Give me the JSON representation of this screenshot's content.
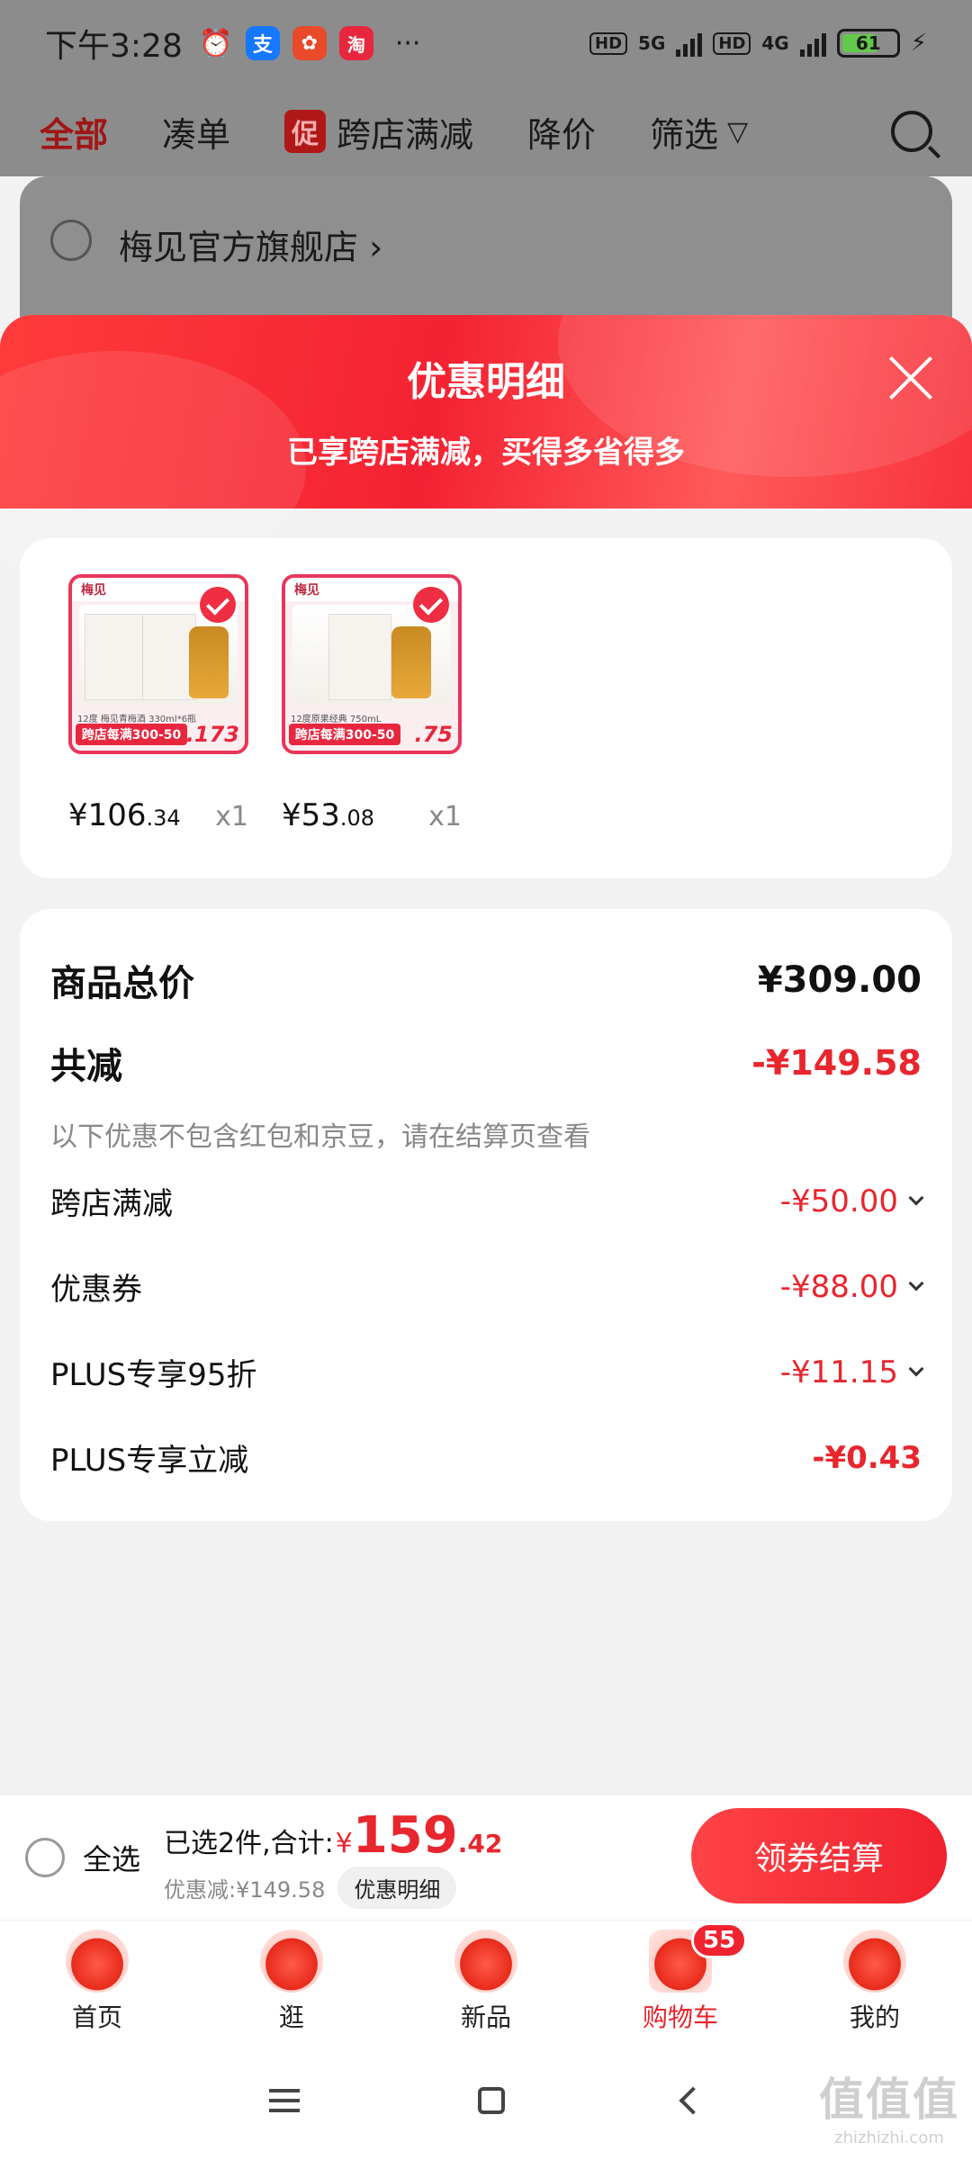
{
  "status_bar": {
    "time": "下午3:28",
    "apps": [
      {
        "name": "alarm-icon",
        "glyph": "⏰",
        "color": "#8c8c8c"
      },
      {
        "name": "alipay-icon",
        "glyph": "支",
        "color": "#1677ff"
      },
      {
        "name": "app-icon",
        "glyph": "✿",
        "color": "#e84a2a"
      },
      {
        "name": "taobao-icon",
        "glyph": "淘",
        "color": "#e8263e"
      }
    ],
    "more": "···",
    "hd1": "HD",
    "net1": "5G",
    "hd2": "HD",
    "net2": "4G",
    "battery": "61"
  },
  "top_tabs": {
    "all": "全部",
    "coudan": "凑单",
    "promo_badge": "促",
    "cross_store": "跨店满减",
    "price_drop": "降价",
    "filter": "筛选"
  },
  "store": {
    "name": "梅见官方旗舰店 ›"
  },
  "sheet": {
    "title": "优惠明细",
    "subtitle": "已享跨店满减，买得多省得多",
    "products": [
      {
        "brand": "梅见",
        "caption": "12度 梅见青梅酒 330ml*6瓶",
        "promo": "跨店每满300-50",
        "thumb_price": ".173",
        "price_int": "¥106",
        "price_dec": ".34",
        "qty": "x1"
      },
      {
        "brand": "梅见",
        "caption": "12度原果经典 750mL",
        "promo": "跨店每满300-50",
        "thumb_price": ".75",
        "price_int": "¥53",
        "price_dec": ".08",
        "qty": "x1"
      }
    ],
    "summary": {
      "total_label": "商品总价",
      "total_value": "¥309.00",
      "reduce_label": "共减",
      "reduce_value": "-¥149.58",
      "note": "以下优惠不包含红包和京豆，请在结算页查看",
      "items": [
        {
          "label": "跨店满减",
          "value": "-¥50.00"
        },
        {
          "label": "优惠券",
          "value": "-¥88.00"
        },
        {
          "label": "PLUS专享95折",
          "value": "-¥11.15"
        },
        {
          "label": "PLUS专享立减",
          "value": "-¥0.43"
        }
      ]
    }
  },
  "checkout": {
    "select_all": "全选",
    "selected_text": "已选2件,合计:",
    "currency": "¥",
    "total_int": "159",
    "total_dec": ".42",
    "discount_text": "优惠减:¥149.58",
    "detail_chip": "优惠明细",
    "button": "领券结算"
  },
  "bottom_nav": {
    "items": [
      {
        "label": "首页"
      },
      {
        "label": "逛"
      },
      {
        "label": "新品"
      },
      {
        "label": "购物车",
        "badge": "55"
      },
      {
        "label": "我的"
      }
    ]
  },
  "watermark": {
    "big": "值值值",
    "small": "zhizhizhi.com"
  },
  "colors": {
    "accent": "#e8262e",
    "header_gradient_start": "#ff3b3b",
    "header_gradient_end": "#f42232"
  }
}
